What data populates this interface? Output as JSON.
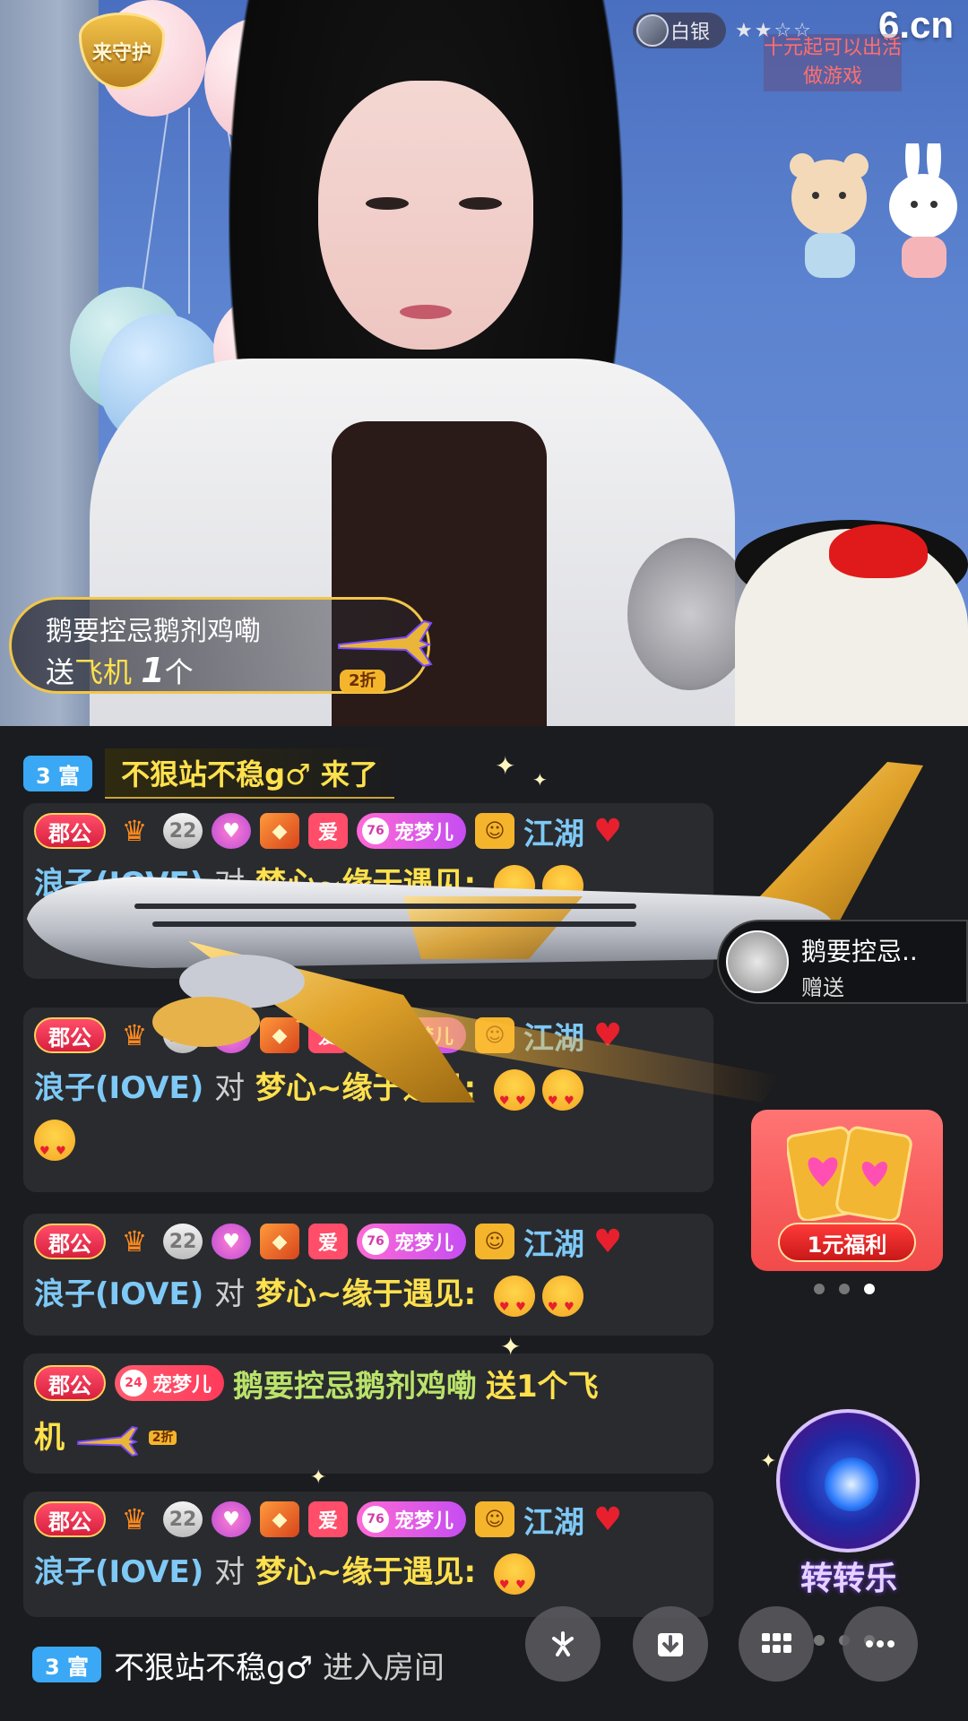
{
  "stream": {
    "guard_badge_text": "来守护",
    "rank_label": "白银",
    "rank_stars": "★★☆☆",
    "site_logo": "6.cn",
    "promo_text": "十元起可以出活做游戏"
  },
  "gift_banner": {
    "sender": "鹅要控忌鹅剂鸡嘞",
    "send_word": "送",
    "gift_name": "飞机",
    "count": "1",
    "unit": "个",
    "discount": "2折"
  },
  "chat": {
    "enter_banner": {
      "level_badge": "3 富",
      "text": "不狠站不稳g♂ 来了"
    },
    "messages": [
      {
        "rank_badge": "郡公",
        "guard_level": "22",
        "love_badge": "爱",
        "pet_level": "76",
        "pet_name": "宠梦儿",
        "user": "江湖",
        "line2_user": "浪子(IOVE)",
        "line2_to": "对",
        "line2_target": "梦心~缘于遇见:"
      },
      {
        "rank_badge": "郡公",
        "guard_level": "22",
        "love_badge": "爱",
        "pet_level": "76",
        "pet_name": "宠梦儿",
        "user": "江湖",
        "line2_user": "浪子(IOVE)",
        "line2_to": "对",
        "line2_target": "梦心~缘于遇见:"
      },
      {
        "rank_badge": "郡公",
        "guard_level": "22",
        "love_badge": "爱",
        "pet_level": "76",
        "pet_name": "宠梦儿",
        "user": "江湖",
        "line2_user": "浪子(IOVE)",
        "line2_to": "对",
        "line2_target": "梦心~缘于遇见:"
      },
      {
        "rank_badge": "郡公",
        "guard_level": "22",
        "love_badge": "爱",
        "pet_level": "76",
        "pet_name": "宠梦儿",
        "user": "江湖",
        "line2_user": "浪子(IOVE)",
        "line2_to": "对",
        "line2_target": "梦心~缘于遇见:"
      }
    ],
    "gift_msg": {
      "rank_badge": "郡公",
      "pet_level": "24",
      "pet_name": "宠梦儿",
      "user": "鹅要控忌鹅剂鸡嘞",
      "action_a": "送1个飞",
      "action_b": "机",
      "discount": "2折"
    },
    "join_msg": {
      "level_badge": "3 富",
      "user": "不狠站不稳g♂",
      "action": "进入房间"
    }
  },
  "side_notice": {
    "name": "鹅要控忌..",
    "action": "赠送"
  },
  "welfare": {
    "button": "1元福利"
  },
  "wheel": {
    "label": "转转乐"
  },
  "toolbar": {
    "icons": [
      "share-icon",
      "download-icon",
      "grid-icon",
      "more-icon"
    ]
  },
  "colors": {
    "accent_gold": "#f1c64a",
    "username_blue": "#7ec9f6",
    "gift_yellow": "#ffe14d",
    "badge_red": "#d8203e"
  }
}
